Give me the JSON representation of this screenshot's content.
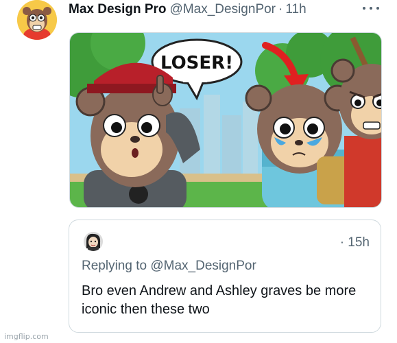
{
  "tweet": {
    "display_name": "Max Design Pro",
    "handle": "@Max_DesignPor",
    "separator": "·",
    "time": "11h",
    "image_text": "LOSER!"
  },
  "quote": {
    "time": "· 15h",
    "replying_prefix": "Replying to ",
    "replying_handle": "@Max_DesignPor",
    "text": "Bro even Andrew and Ashley graves be more iconic then these two"
  },
  "watermark": "imgflip.com",
  "colors": {
    "secondary_text": "#536471",
    "border": "#cfd9de",
    "avatar_bg": "#f7c948"
  },
  "icons": [
    "more-options-icon"
  ]
}
